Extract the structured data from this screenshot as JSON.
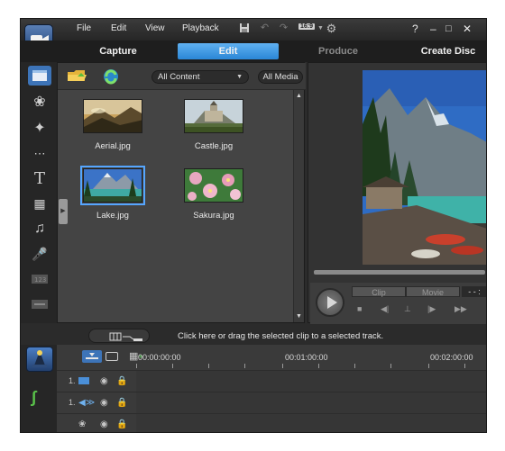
{
  "menu": {
    "items": [
      "File",
      "Edit",
      "View",
      "Playback"
    ],
    "aspect_badge": "16:9",
    "help": "?"
  },
  "modes": {
    "capture": "Capture",
    "edit": "Edit",
    "produce": "Produce",
    "create_disc": "Create Disc"
  },
  "library": {
    "content_filter": "All Content",
    "media_filter": "All Media",
    "clips": [
      {
        "name": "Aerial.jpg",
        "selected": false
      },
      {
        "name": "Castle.jpg",
        "selected": false
      },
      {
        "name": "Lake.jpg",
        "selected": true
      },
      {
        "name": "Sakura.jpg",
        "selected": false
      }
    ]
  },
  "preview": {
    "clip_label": "Clip",
    "movie_label": "Movie",
    "time_display": "- - :"
  },
  "message": {
    "text": "Click here or drag the selected clip to a selected track."
  },
  "timeline": {
    "timecodes": [
      "00:00:00:00",
      "00:01:00:00",
      "00:02:00:00"
    ],
    "tracks": [
      {
        "number": "1.",
        "icon": "video-track-icon"
      },
      {
        "number": "1.",
        "icon": "audio-track-icon"
      },
      {
        "number": "",
        "icon": "effect-track-icon"
      }
    ]
  },
  "colors": {
    "accent": "#3d8fe0",
    "background": "#2b2b2b"
  }
}
